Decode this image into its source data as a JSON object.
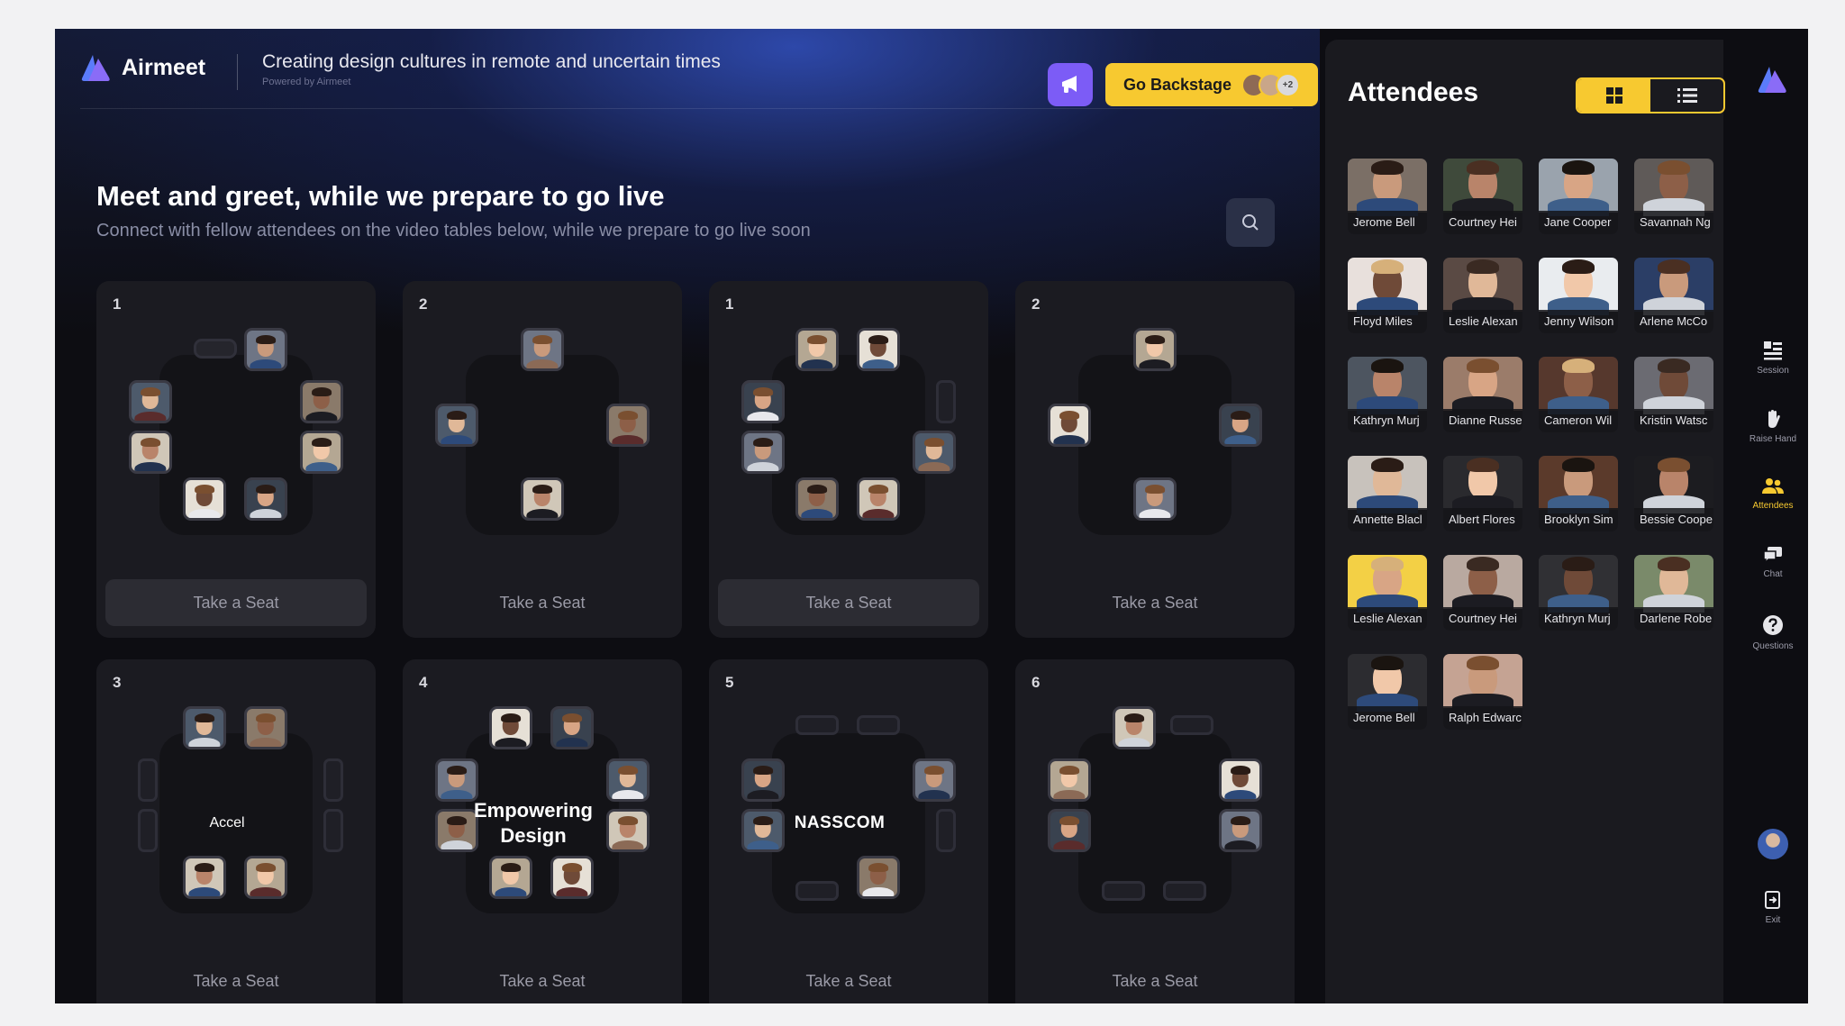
{
  "app": {
    "name": "Airmeet",
    "event_title": "Creating design cultures in remote and uncertain times",
    "powered_by": "Powered by Airmeet"
  },
  "header": {
    "backstage_label": "Go Backstage",
    "backstage_more": "+2"
  },
  "lounge": {
    "headline": "Meet and greet, while we prepare to go live",
    "subline": "Connect with fellow attendees on the video tables below, while we prepare to go live soon",
    "tables": [
      {
        "number": "1",
        "label": "",
        "seat_label": "Take a Seat"
      },
      {
        "number": "2",
        "label": "",
        "seat_label": "Take a Seat"
      },
      {
        "number": "1",
        "label": "",
        "seat_label": "Take a Seat"
      },
      {
        "number": "2",
        "label": "",
        "seat_label": "Take a Seat"
      },
      {
        "number": "3",
        "label": "Accel",
        "seat_label": "Take a Seat"
      },
      {
        "number": "4",
        "label": "Empowering Design",
        "seat_label": "Take a Seat"
      },
      {
        "number": "5",
        "label": "NASSCOM",
        "seat_label": "Take a Seat"
      },
      {
        "number": "6",
        "label": "",
        "seat_label": "Take a Seat"
      }
    ]
  },
  "attendees": {
    "title": "Attendees",
    "view_mode": "grid",
    "list": [
      "Jerome Bell",
      "Courtney Hei",
      "Jane Cooper",
      "Savannah Ng",
      "Floyd Miles",
      "Leslie Alexan",
      "Jenny Wilson",
      "Arlene McCo",
      "Kathryn Murj",
      "Dianne Russe",
      "Cameron Wil",
      "Kristin Watsc",
      "Annette Blacl",
      "Albert Flores",
      "Brooklyn Sim",
      "Bessie Coope",
      "Leslie Alexan",
      "Courtney Hei",
      "Kathryn Murj",
      "Darlene Robe",
      "Jerome Bell",
      "Ralph Edwarc"
    ]
  },
  "rail": {
    "session": "Session",
    "raise_hand": "Raise Hand",
    "attendees": "Attendees",
    "chat": "Chat",
    "questions": "Questions",
    "exit": "Exit"
  },
  "colors": {
    "accent": "#f7c930",
    "brand": "#7c5cf6",
    "panel": "#1a1a1f",
    "card": "#1b1b21"
  }
}
